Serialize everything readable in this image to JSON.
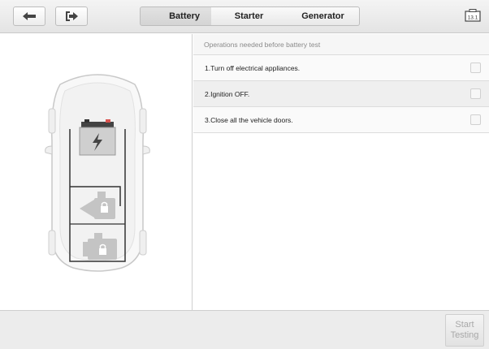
{
  "toolbar": {
    "back_icon": "back-arrow-icon",
    "exit_icon": "exit-icon",
    "tabs": [
      {
        "label": "Battery",
        "active": true
      },
      {
        "label": "Starter",
        "active": false
      },
      {
        "label": "Generator",
        "active": false
      }
    ],
    "version_badge": "13.1"
  },
  "diagram": {
    "battery_icon": "lightning-icon",
    "generator_icon": "lock-icon",
    "starter_icon": "lock-icon"
  },
  "operations": {
    "header": "Operations needed before battery test",
    "items": [
      {
        "label": "1.Turn off electrical appliances.",
        "checked": false
      },
      {
        "label": "2.Ignition OFF.",
        "checked": false
      },
      {
        "label": "3.Close all the vehicle doors.",
        "checked": false
      }
    ]
  },
  "footer": {
    "start_line1": "Start",
    "start_line2": "Testing"
  },
  "colors": {
    "toolbar_bg": "#e9e9e9",
    "active_tab": "#d8d8d8",
    "disabled_text": "#a8a8a8",
    "battery_red": "#d9534f"
  }
}
